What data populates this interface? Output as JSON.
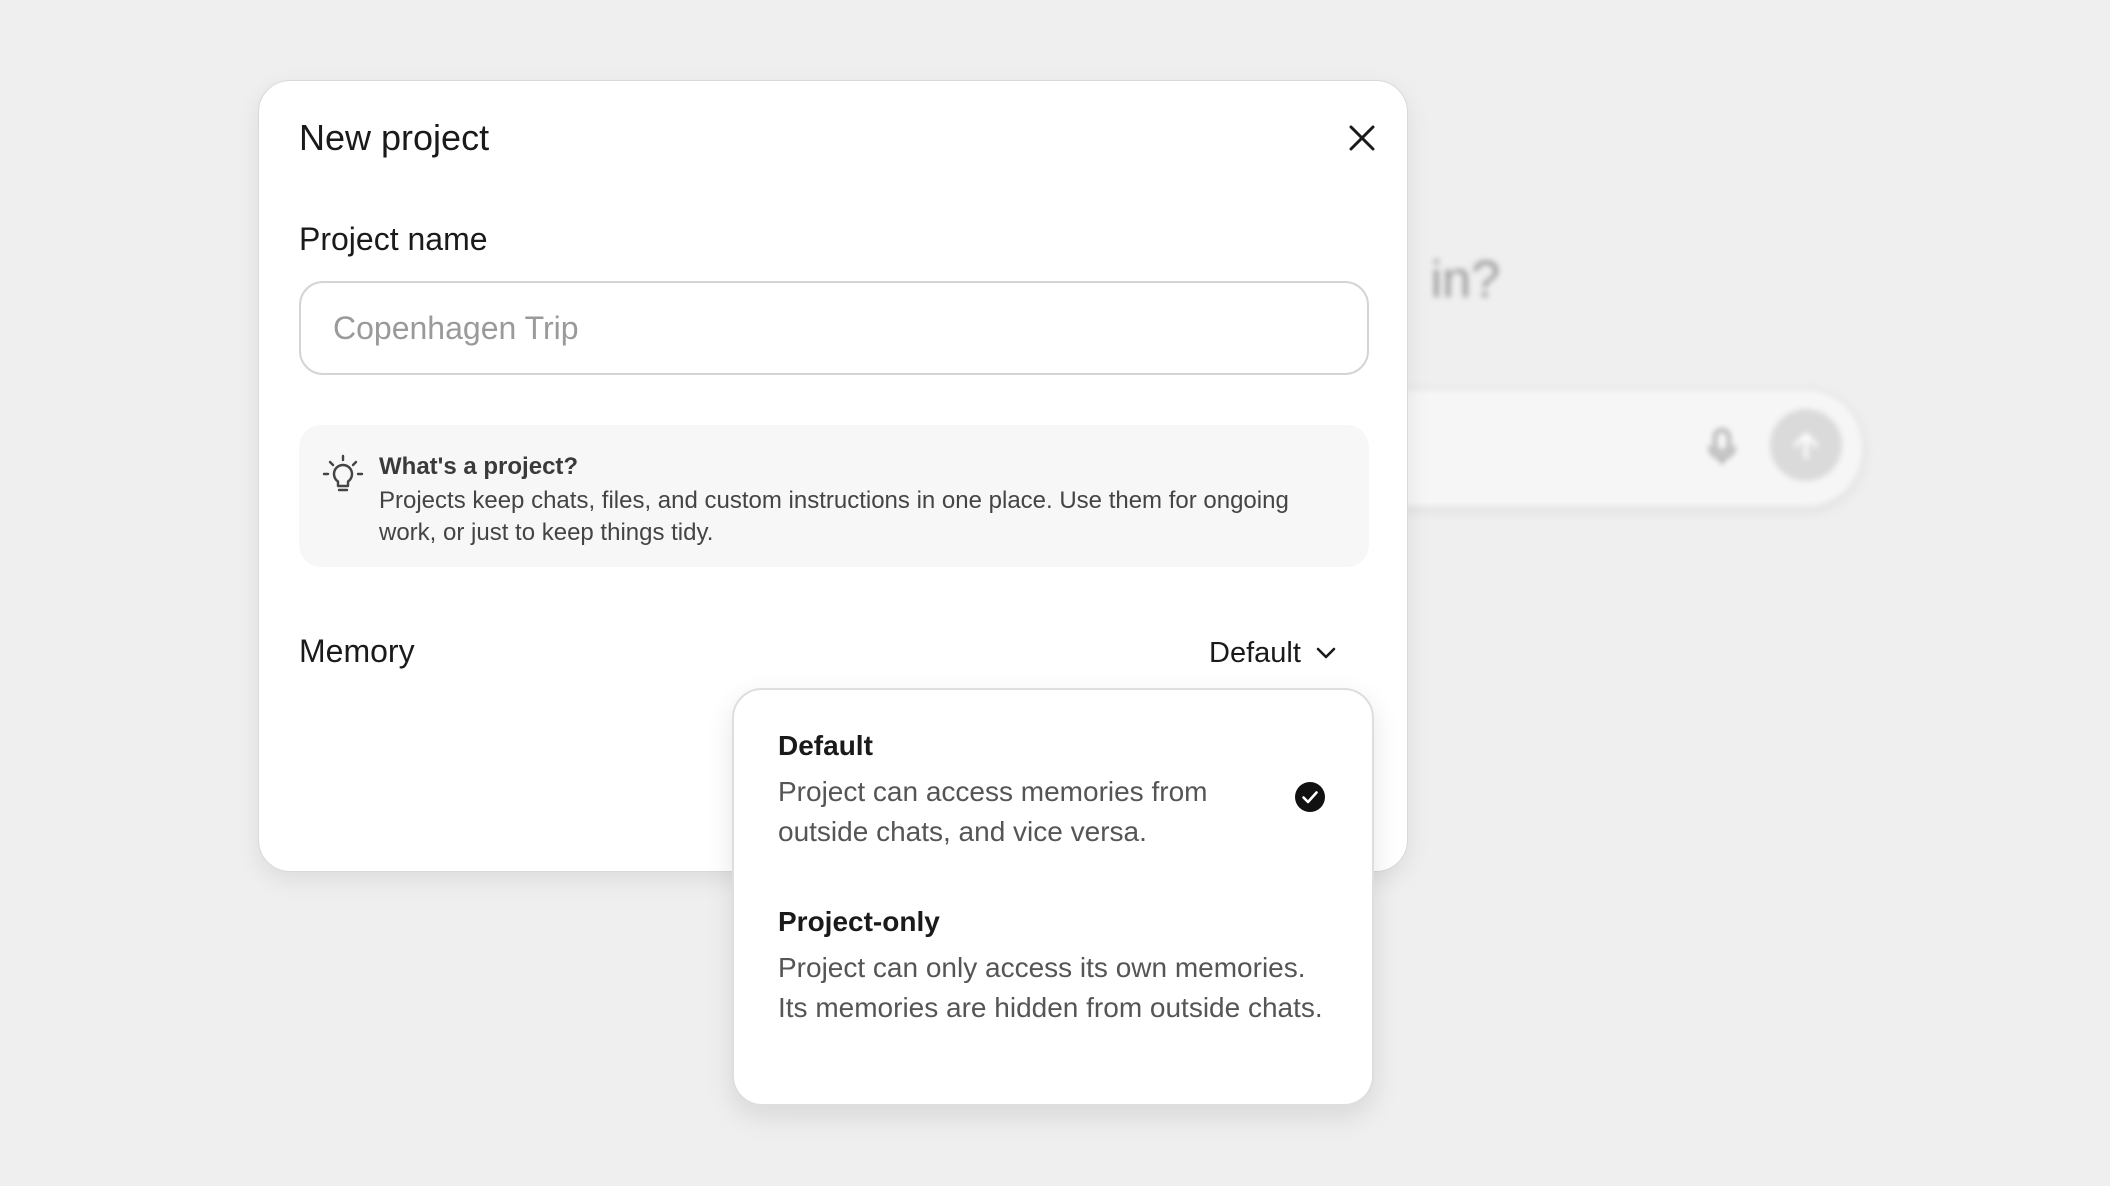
{
  "background": {
    "heading_fragment": "in?",
    "icons": {
      "mic": "microphone-icon",
      "send": "arrow-up-icon"
    }
  },
  "modal": {
    "title": "New project",
    "close_icon": "close-icon",
    "project_name": {
      "label": "Project name",
      "value": "",
      "placeholder": "Copenhagen Trip"
    },
    "info": {
      "icon": "lightbulb-icon",
      "title": "What's a project?",
      "body": "Projects keep chats, files, and custom instructions in one place. Use them for ongoing work, or just to keep things tidy."
    },
    "memory": {
      "label": "Memory",
      "selected": "Default",
      "chevron_icon": "chevron-down-icon"
    }
  },
  "dropdown": {
    "options": [
      {
        "title": "Default",
        "description": "Project can access memories from outside chats, and vice versa.",
        "selected": true
      },
      {
        "title": "Project-only",
        "description": "Project can only access its own memories. Its memories are hidden from outside chats.",
        "selected": false
      }
    ],
    "check_icon": "checkmark-circle-icon"
  },
  "colors": {
    "backdrop": "#efefef",
    "surface": "#ffffff",
    "info_bg": "#f7f7f7",
    "text_primary": "#1a1a1a",
    "text_secondary": "#555555",
    "placeholder": "#9a9a9a"
  }
}
